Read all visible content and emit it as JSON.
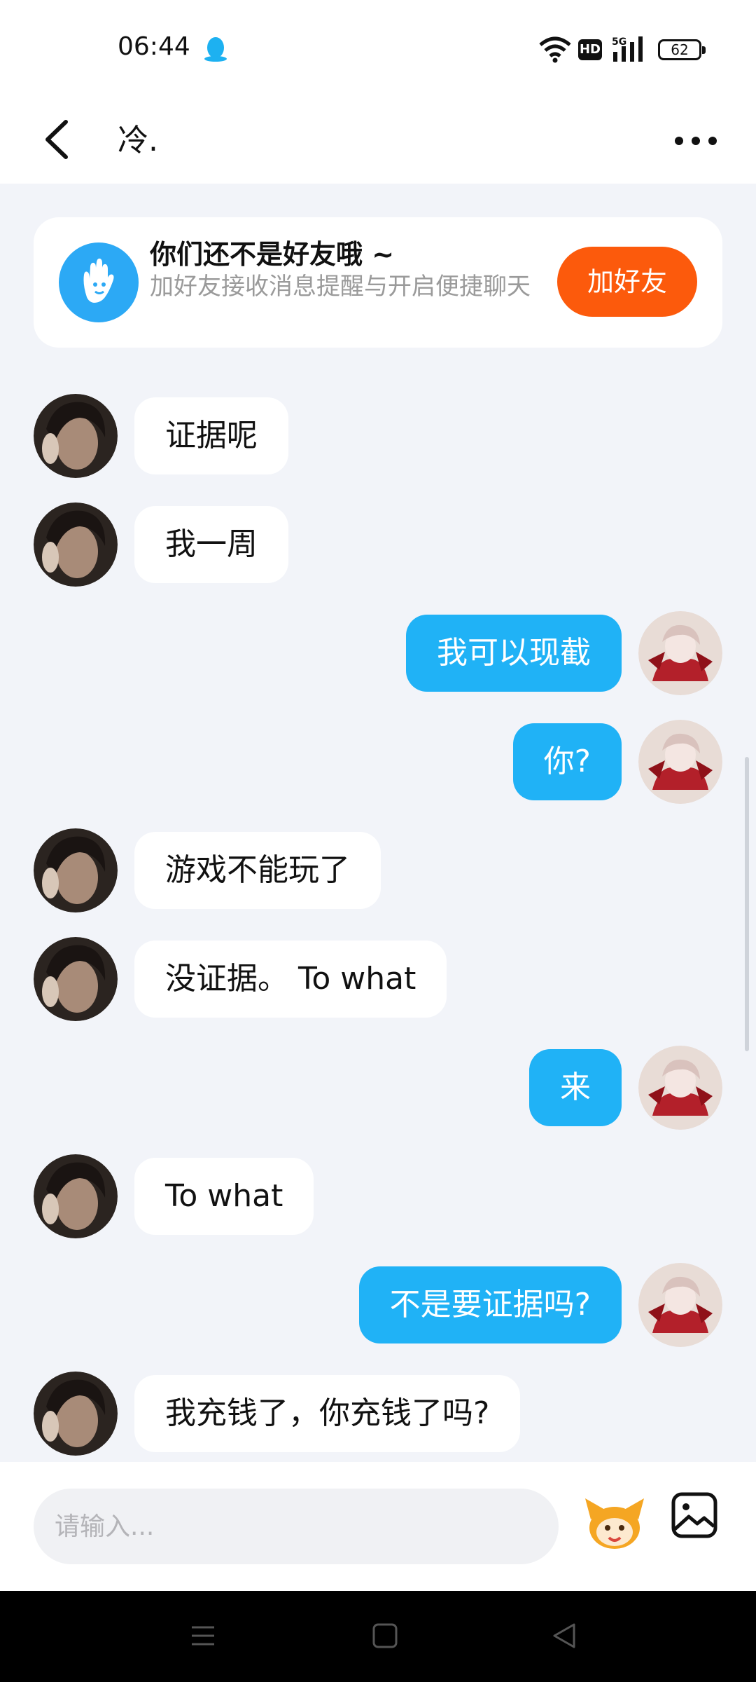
{
  "status_bar": {
    "time": "06:44",
    "hd_label": "HD",
    "battery_level": "62",
    "network": "5G"
  },
  "header": {
    "title": "冷."
  },
  "friend_banner": {
    "title": "你们还不是好友哦 ~",
    "subtitle": "加好友接收消息提醒与开启便捷聊天",
    "button_label": "加好友"
  },
  "messages": [
    {
      "side": "in",
      "text": "证据呢"
    },
    {
      "side": "in",
      "text": "我一周"
    },
    {
      "side": "out",
      "text": "我可以现截"
    },
    {
      "side": "out",
      "text": "你?"
    },
    {
      "side": "in",
      "text": "游戏不能玩了"
    },
    {
      "side": "in",
      "text": "没证据。 To what"
    },
    {
      "side": "out",
      "text": "来"
    },
    {
      "side": "in",
      "text": "To what"
    },
    {
      "side": "out",
      "text": "不是要证据吗?"
    },
    {
      "side": "in",
      "text": "我充钱了，你充钱了吗?"
    }
  ],
  "input": {
    "placeholder": "请输入..."
  },
  "icons": {
    "back": "back-arrow-icon",
    "more": "more-dots-icon",
    "hand": "hand-wave-icon",
    "emoji": "emoji-mascot-icon",
    "image": "image-icon"
  },
  "colors": {
    "accent_blue": "#20b2f6",
    "add_friend_orange": "#fc5a0c",
    "background": "#f2f4f9"
  }
}
